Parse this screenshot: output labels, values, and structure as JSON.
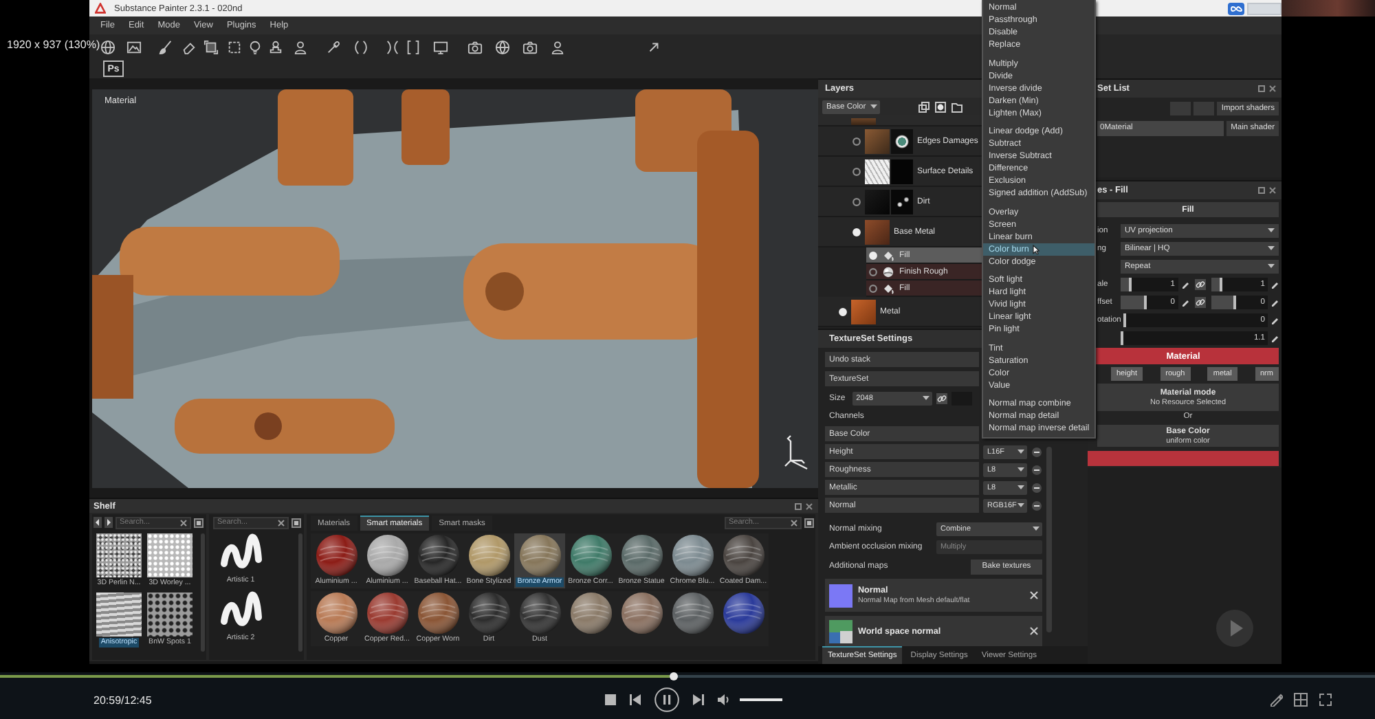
{
  "screen_overlay": {
    "resolution": "1920 x 937 (130%)"
  },
  "window": {
    "title": "Substance Painter 2.3.1 - 020nd"
  },
  "menu": [
    "File",
    "Edit",
    "Mode",
    "View",
    "Plugins",
    "Help"
  ],
  "toolbar": {
    "photoshop_button": "Ps"
  },
  "viewport": {
    "mode_label": "Material"
  },
  "layers": {
    "title": "Layers",
    "channel": "Base Color",
    "items": [
      {
        "selected": false,
        "children": [
          {
            "name": "Edges Damages",
            "visible": false,
            "mask": true,
            "selected": false
          },
          {
            "name": "Surface Details",
            "visible": false,
            "mask": true,
            "selected": false
          },
          {
            "name": "Dirt",
            "visible": false,
            "mask": true,
            "selected": false
          },
          {
            "name": "Base Metal",
            "visible": true,
            "mask": false,
            "selected": false,
            "children": [
              {
                "name": "Fill",
                "kind": "fill",
                "visible": true,
                "selected": true
              },
              {
                "name": "Finish Rough",
                "kind": "generator",
                "visible": false,
                "selected": false
              },
              {
                "name": "Fill",
                "kind": "fill",
                "visible": false,
                "selected": false
              }
            ]
          }
        ]
      },
      {
        "name": "Metal",
        "visible": true,
        "mask": false,
        "selected": false
      }
    ]
  },
  "blend_menu": {
    "groups": [
      {
        "items": [
          {
            "label": "Normal",
            "selected": false
          },
          {
            "label": "Passthrough",
            "selected": false
          },
          {
            "label": "Disable",
            "selected": false
          },
          {
            "label": "Replace",
            "selected": false
          }
        ]
      },
      {
        "items": [
          {
            "label": "Multiply",
            "selected": false
          },
          {
            "label": "Divide",
            "selected": false
          },
          {
            "label": "Inverse divide",
            "selected": false
          },
          {
            "label": "Darken (Min)",
            "selected": false
          },
          {
            "label": "Lighten (Max)",
            "selected": false
          }
        ]
      },
      {
        "items": [
          {
            "label": "Linear dodge (Add)",
            "selected": false
          },
          {
            "label": "Subtract",
            "selected": false
          },
          {
            "label": "Inverse Subtract",
            "selected": false
          },
          {
            "label": "Difference",
            "selected": false
          },
          {
            "label": "Exclusion",
            "selected": false
          },
          {
            "label": "Signed addition (AddSub)",
            "selected": false
          }
        ]
      },
      {
        "items": [
          {
            "label": "Overlay",
            "selected": false
          },
          {
            "label": "Screen",
            "selected": false
          },
          {
            "label": "Linear burn",
            "selected": false
          },
          {
            "label": "Color burn",
            "selected": true
          },
          {
            "label": "Color dodge",
            "selected": false
          }
        ]
      },
      {
        "items": [
          {
            "label": "Soft light",
            "selected": false
          },
          {
            "label": "Hard light",
            "selected": false
          },
          {
            "label": "Vivid light",
            "selected": false
          },
          {
            "label": "Linear light",
            "selected": false
          },
          {
            "label": "Pin light",
            "selected": false
          }
        ]
      },
      {
        "items": [
          {
            "label": "Tint",
            "selected": false
          },
          {
            "label": "Saturation",
            "selected": false
          },
          {
            "label": "Color",
            "selected": false
          },
          {
            "label": "Value",
            "selected": false
          }
        ]
      },
      {
        "items": [
          {
            "label": "Normal map combine",
            "selected": false
          },
          {
            "label": "Normal map detail",
            "selected": false
          },
          {
            "label": "Normal map inverse detail",
            "selected": false
          }
        ]
      }
    ]
  },
  "texture_set_settings": {
    "title": "TextureSet Settings",
    "undo_stack": "Undo stack",
    "texture_set": "TextureSet",
    "size_label": "Size",
    "size": "2048",
    "channels_label": "Channels",
    "channels": [
      {
        "name": "Base Color"
      },
      {
        "name": "Height",
        "format": "L16F"
      },
      {
        "name": "Roughness",
        "format": "L8"
      },
      {
        "name": "Metallic",
        "format": "L8"
      },
      {
        "name": "Normal",
        "format": "RGB16F"
      }
    ],
    "normal_mixing": {
      "label": "Normal mixing",
      "value": "Combine"
    },
    "ao_mixing": {
      "label": "Ambient occlusion mixing",
      "value": "Multiply",
      "disabled": true
    },
    "additional_maps": {
      "label": "Additional maps",
      "button": "Bake textures"
    },
    "maps": [
      {
        "kind": "normal",
        "name": "Normal",
        "source": "Normal Map from Mesh default/flat"
      },
      {
        "kind": "world_normal",
        "name": "World space normal"
      }
    ],
    "tabs": [
      {
        "label": "TextureSet Settings",
        "selected": true
      },
      {
        "label": "Display Settings",
        "selected": false
      },
      {
        "label": "Viewer Settings",
        "selected": false
      }
    ]
  },
  "texture_set_list": {
    "title": "Set List",
    "import_button": "Import shaders",
    "sets": [
      {
        "name": "0Material",
        "shader": "Main shader"
      }
    ]
  },
  "properties": {
    "title": "es - Fill",
    "layer_name": "Fill",
    "rows": [
      {
        "kind": "select",
        "label": "ion",
        "value": "UV projection"
      },
      {
        "kind": "select",
        "label": "ng",
        "value": "Bilinear | HQ"
      },
      {
        "kind": "select",
        "value": "Repeat"
      },
      {
        "kind": "slider",
        "label": "ale",
        "fields": [
          {
            "value": "1",
            "level": 0.2
          },
          {
            "value": "1",
            "level": 0.2
          }
        ]
      },
      {
        "kind": "slider",
        "label": "ffset",
        "fields": [
          {
            "value": "0",
            "level": 0.45
          },
          {
            "value": "0",
            "level": 0.45
          }
        ]
      },
      {
        "kind": "slider",
        "label": "otation",
        "fields": [
          {
            "value": "0",
            "level": 0
          }
        ]
      },
      {
        "kind": "slider",
        "fields": [
          {
            "value": "1.1",
            "level": 0
          }
        ]
      }
    ],
    "material": {
      "title": "Material",
      "channels": [
        "height",
        "rough",
        "metal",
        "nrm"
      ],
      "mode_title": "Material mode",
      "mode_value": "No Resource Selected",
      "or": "Or",
      "base_color_title": "Base Color",
      "base_color_value": "uniform color"
    }
  },
  "shelf": {
    "title": "Shelf",
    "texture_search": {
      "placeholder": "Search..."
    },
    "textures": [
      {
        "name": "3D Perlin N...",
        "selected": false
      },
      {
        "name": "3D Worley ...",
        "selected": false
      },
      {
        "name": "Anisotropic",
        "selected": true
      },
      {
        "name": "BnW Spots 1",
        "selected": false
      }
    ],
    "brush_search": {
      "placeholder": "Search..."
    },
    "brushes": [
      {
        "name": "Artistic 1"
      },
      {
        "name": "Artistic 2"
      }
    ],
    "tabs": [
      {
        "label": "Materials",
        "selected": false
      },
      {
        "label": "Smart materials",
        "selected": true
      },
      {
        "label": "Smart masks",
        "selected": false
      }
    ],
    "material_search": {
      "placeholder": "Search..."
    },
    "materials": [
      {
        "name": "Aluminium ...",
        "color": "#8c1c16",
        "selected": false
      },
      {
        "name": "Aluminium ...",
        "color": "#a9a9a9",
        "selected": false
      },
      {
        "name": "Baseball Hat...",
        "color": "#262626",
        "selected": false
      },
      {
        "name": "Bone Stylized",
        "color": "#b09868",
        "selected": false
      },
      {
        "name": "Bronze Armor",
        "color": "#86765a",
        "selected": true
      },
      {
        "name": "Bronze Corr...",
        "color": "#3f7a68",
        "selected": false
      },
      {
        "name": "Bronze Statue",
        "color": "#5a6a68",
        "selected": false
      },
      {
        "name": "Chrome Blu...",
        "color": "#7c8a90",
        "selected": false
      },
      {
        "name": "Coated Dam...",
        "color": "#4a4440",
        "selected": false
      },
      {
        "name": "Copper",
        "color": "#b87a55",
        "selected": false
      },
      {
        "name": "Copper Red...",
        "color": "#9a3a30",
        "selected": false
      },
      {
        "name": "Copper Worn",
        "color": "#8a5535",
        "selected": false
      },
      {
        "name": "Dirt",
        "color": "#2c2c2c",
        "selected": false
      },
      {
        "name": "Dust",
        "color": "#323232",
        "selected": false
      },
      {
        "color": "#8a7a68",
        "selected": false
      },
      {
        "color": "#8a7060",
        "selected": false
      },
      {
        "color": "#5c6062",
        "selected": false
      },
      {
        "color": "#2a3a9a",
        "selected": false
      }
    ]
  },
  "player": {
    "progress": {
      "level": 0.49
    },
    "time": "20:59/12:45",
    "volume": {
      "level": 1
    }
  }
}
